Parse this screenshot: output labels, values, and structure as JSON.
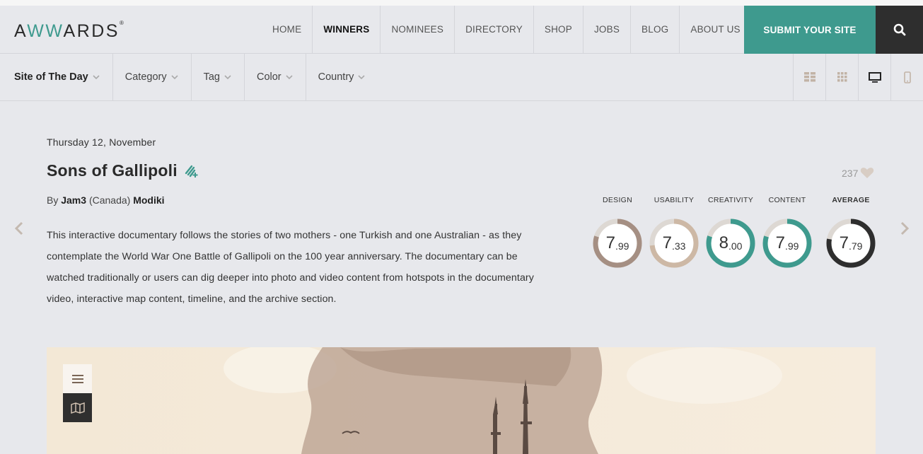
{
  "header": {
    "logo_prefix": "A",
    "logo_middle": "WW",
    "logo_suffix": "ARDS",
    "logo_mark": "®",
    "nav": [
      "HOME",
      "WINNERS",
      "NOMINEES",
      "DIRECTORY",
      "SHOP",
      "JOBS",
      "BLOG",
      "ABOUT US"
    ],
    "active_nav": "WINNERS",
    "submit_label": "SUBMIT YOUR SITE",
    "search_icon": "search-icon",
    "accent_color": "#3e9a8e"
  },
  "filters": {
    "items": [
      "Site of The Day",
      "Category",
      "Tag",
      "Color",
      "Country"
    ],
    "views": [
      "grid-large-icon",
      "grid-small-icon",
      "desktop-icon",
      "mobile-icon"
    ]
  },
  "site": {
    "date": "Thursday 12, November",
    "title": "Sons of Gallipoli",
    "by": "By",
    "author": "Jam3",
    "country": "(Canada)",
    "collab": "Modiki",
    "likes": "237",
    "description": "This interactive documentary follows the stories of two mothers - one Turkish and one Australian - as they contemplate the World War One Battle of Gallipoli on the 100 year anniversary. The documentary can be watched traditionally or users can dig deeper into photo and video content from hotspots in the documentary video, interactive map content, timeline, and the archive section."
  },
  "scores": [
    {
      "label": "DESIGN",
      "int": "7",
      "dec": ".99",
      "value": 7.99,
      "color": "#a58f83"
    },
    {
      "label": "USABILITY",
      "int": "7",
      "dec": ".33",
      "value": 7.33,
      "color": "#cdb8a5"
    },
    {
      "label": "CREATIVITY",
      "int": "8",
      "dec": ".00",
      "value": 8.0,
      "color": "#3e9a8e"
    },
    {
      "label": "CONTENT",
      "int": "7",
      "dec": ".99",
      "value": 7.99,
      "color": "#3e9a8e"
    },
    {
      "label": "AVERAGE",
      "int": "7",
      "dec": ".79",
      "value": 7.79,
      "color": "#2e2e2e"
    }
  ]
}
